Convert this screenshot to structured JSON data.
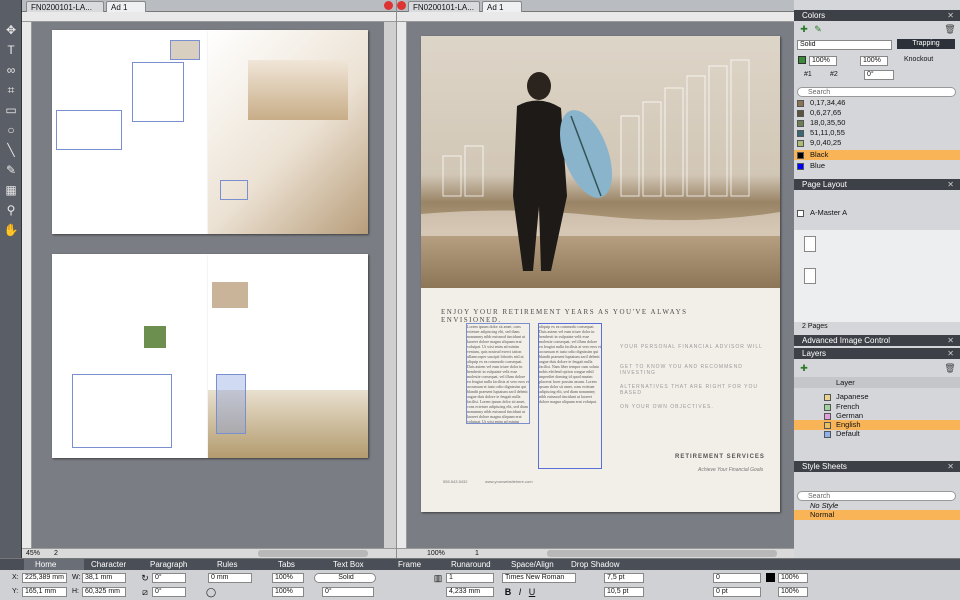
{
  "tabs_left": {
    "doc": "FN0200101-LA...",
    "layout": "Ad 1"
  },
  "tabs_right": {
    "doc": "FN0200101-LA...",
    "layout": "Ad 1"
  },
  "left_status": {
    "zoom": "45%",
    "page": "2"
  },
  "right_status": {
    "zoom": "100%",
    "page": "1"
  },
  "tools": [
    "move-icon",
    "text-icon",
    "link-icon",
    "crop-icon",
    "rectangle-icon",
    "oval-icon",
    "line-icon",
    "pen-icon",
    "table-icon",
    "zoom-icon",
    "hand-icon"
  ],
  "ad": {
    "headline": "ENJOY YOUR RETIREMENT YEARS AS YOU'VE ALWAYS ENVISIONED.",
    "body": "Lorem ipsum dolor sit amet, cons ectetuer adipiscing elit, sed diam nonummy nibh euismod tincidunt ut laoreet dolore magna aliquam erat volutpat. Ut wisi enim ad minim veniam, quis nostrud exerci tation ullamcorper suscipit lobortis nisl ut aliquip ex ea commodo consequat. Duis autem vel eum iriure dolor in hendrerit in vulputate velit esse molestie consequat, vel illum dolore eu feugiat nulla facilisis at vero eros et accumsan et iusto odio dignissim qui blandit praesent luptatum zzril delenit augue duis dolore te feugait nulla facilisi. Lorem ipsum dolor sit amet, cons ectetuer adipiscing elit, sed diam nonummy nibh euismod tincidunt ut laoreet dolore magna aliquam erat volutpat. Ut wisi enim ad minim veniam, quis nostrud exerci tation ullamcorper suscipit lobortis nisl ut aliquip ex ea commodo consequat.",
    "body2": "aliquip ex ea commodo consequat. Duis autem vel eum iriure dolor in hendrerit in vulputate velit esse molestie consequat, vel illum dolore eu feugiat nulla facilisis at vero eros et accumsan et iusto odio dignissim qui blandit praesent luptatum zzril delenit augue duis dolore te feugait nulla facilisi. Nam liber tempor cum soluta nobis eleifend option congue nihil imperdiet doming id quod mazim placerat facer possim assum. Lorem ipsum dolor sit amet, cons ectetuer adipiscing elit, sed diam nonummy nibh euismod tincidunt ut laoreet dolore magna aliquam erat volutpat.",
    "pitch1": "YOUR PERSONAL FINANCIAL ADVISOR WILL",
    "pitch2": "GET TO KNOW YOU AND RECOMMEND INVESTING",
    "pitch3": "ALTERNATIVES THAT ARE RIGHT FOR YOU BASED",
    "pitch4": "ON YOUR OWN OBJECTIVES.",
    "brand": "RETIREMENT SERVICES",
    "tagline": "Achieve Your Financial Goals",
    "phone": "555.543.5432",
    "url": "www.yourwebsitehere.com"
  },
  "colors": {
    "title": "Colors",
    "mode": "Solid",
    "trapping": "Trapping",
    "knockout": "Knockout",
    "opacity1": "100%",
    "opacity2": "100%",
    "angle": "0°",
    "mode1": "#1",
    "mode2": "#2",
    "search": "Search",
    "items": [
      {
        "name": "0,17,34,46",
        "hex": "#8c7353"
      },
      {
        "name": "0,6,27,65",
        "hex": "#5a543f"
      },
      {
        "name": "18,0,35,50",
        "hex": "#6b7f53"
      },
      {
        "name": "51,11,0,55",
        "hex": "#386873"
      },
      {
        "name": "9,0,40,25",
        "hex": "#aabd72"
      },
      {
        "name": "Black",
        "hex": "#000000"
      },
      {
        "name": "Blue",
        "hex": "#0000ff"
      }
    ]
  },
  "page_layout": {
    "title": "Page Layout",
    "master": "A-Master A",
    "pages": "2 Pages"
  },
  "image_control": {
    "title": "Advanced Image Control"
  },
  "layers": {
    "title": "Layers",
    "column": "Layer",
    "items": [
      {
        "name": "Japanese",
        "hex": "#e8d48a"
      },
      {
        "name": "French",
        "hex": "#9fd49f"
      },
      {
        "name": "German",
        "hex": "#e0a0e0"
      },
      {
        "name": "English",
        "hex": "#e8c060"
      },
      {
        "name": "Default",
        "hex": "#8fb0e8"
      }
    ]
  },
  "style_sheets": {
    "title": "Style Sheets",
    "search": "Search",
    "items": [
      "No Style",
      "Normal"
    ]
  },
  "measure": {
    "tabs": [
      "Home",
      "Character",
      "Paragraph",
      "Rules",
      "Tabs",
      "Text Box",
      "Frame",
      "Runaround",
      "Space/Align",
      "Drop Shadow"
    ],
    "x": "225,389 mm",
    "y": "165,1 mm",
    "w": "38,1 mm",
    "h": "60,325 mm",
    "angle1": "0°",
    "angle2": "0°",
    "frame": "0 mm",
    "shade1": "100%",
    "shade2": "100%",
    "style": "Solid",
    "cols": "1",
    "gutter": "4,233 mm",
    "font": "Times New Roman",
    "size": "7,5 pt",
    "leading": "10,5 pt",
    "track": "0",
    "base": "0 pt",
    "shade3": "100%",
    "shade4": "100%"
  }
}
